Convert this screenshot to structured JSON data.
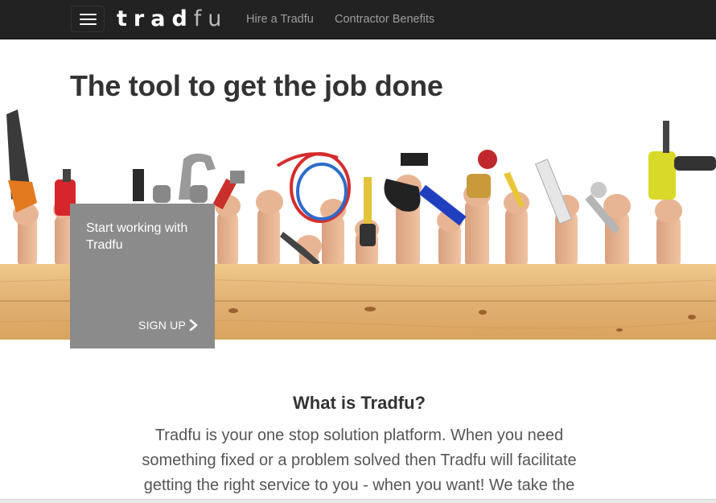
{
  "navbar": {
    "brand_bold": "trad",
    "brand_light": "fu",
    "links": [
      "Hire a Tradfu",
      "Contractor Benefits"
    ]
  },
  "hero": {
    "headline": "The tool to get the job done"
  },
  "signup_card": {
    "text": "Start working with Tradfu",
    "link_label": "SIGN UP"
  },
  "about": {
    "title": "What is Tradfu?",
    "body": "Tradfu is your one stop solution platform. When you need something fixed or a problem solved then Tradfu will facilitate getting the right service to you - when you want! We take the"
  },
  "colors": {
    "navbar_bg": "#222222",
    "card_bg": "#8b8b8b",
    "wood": "#e2b878"
  },
  "icons": [
    "menu-icon",
    "chevron-right-icon"
  ]
}
